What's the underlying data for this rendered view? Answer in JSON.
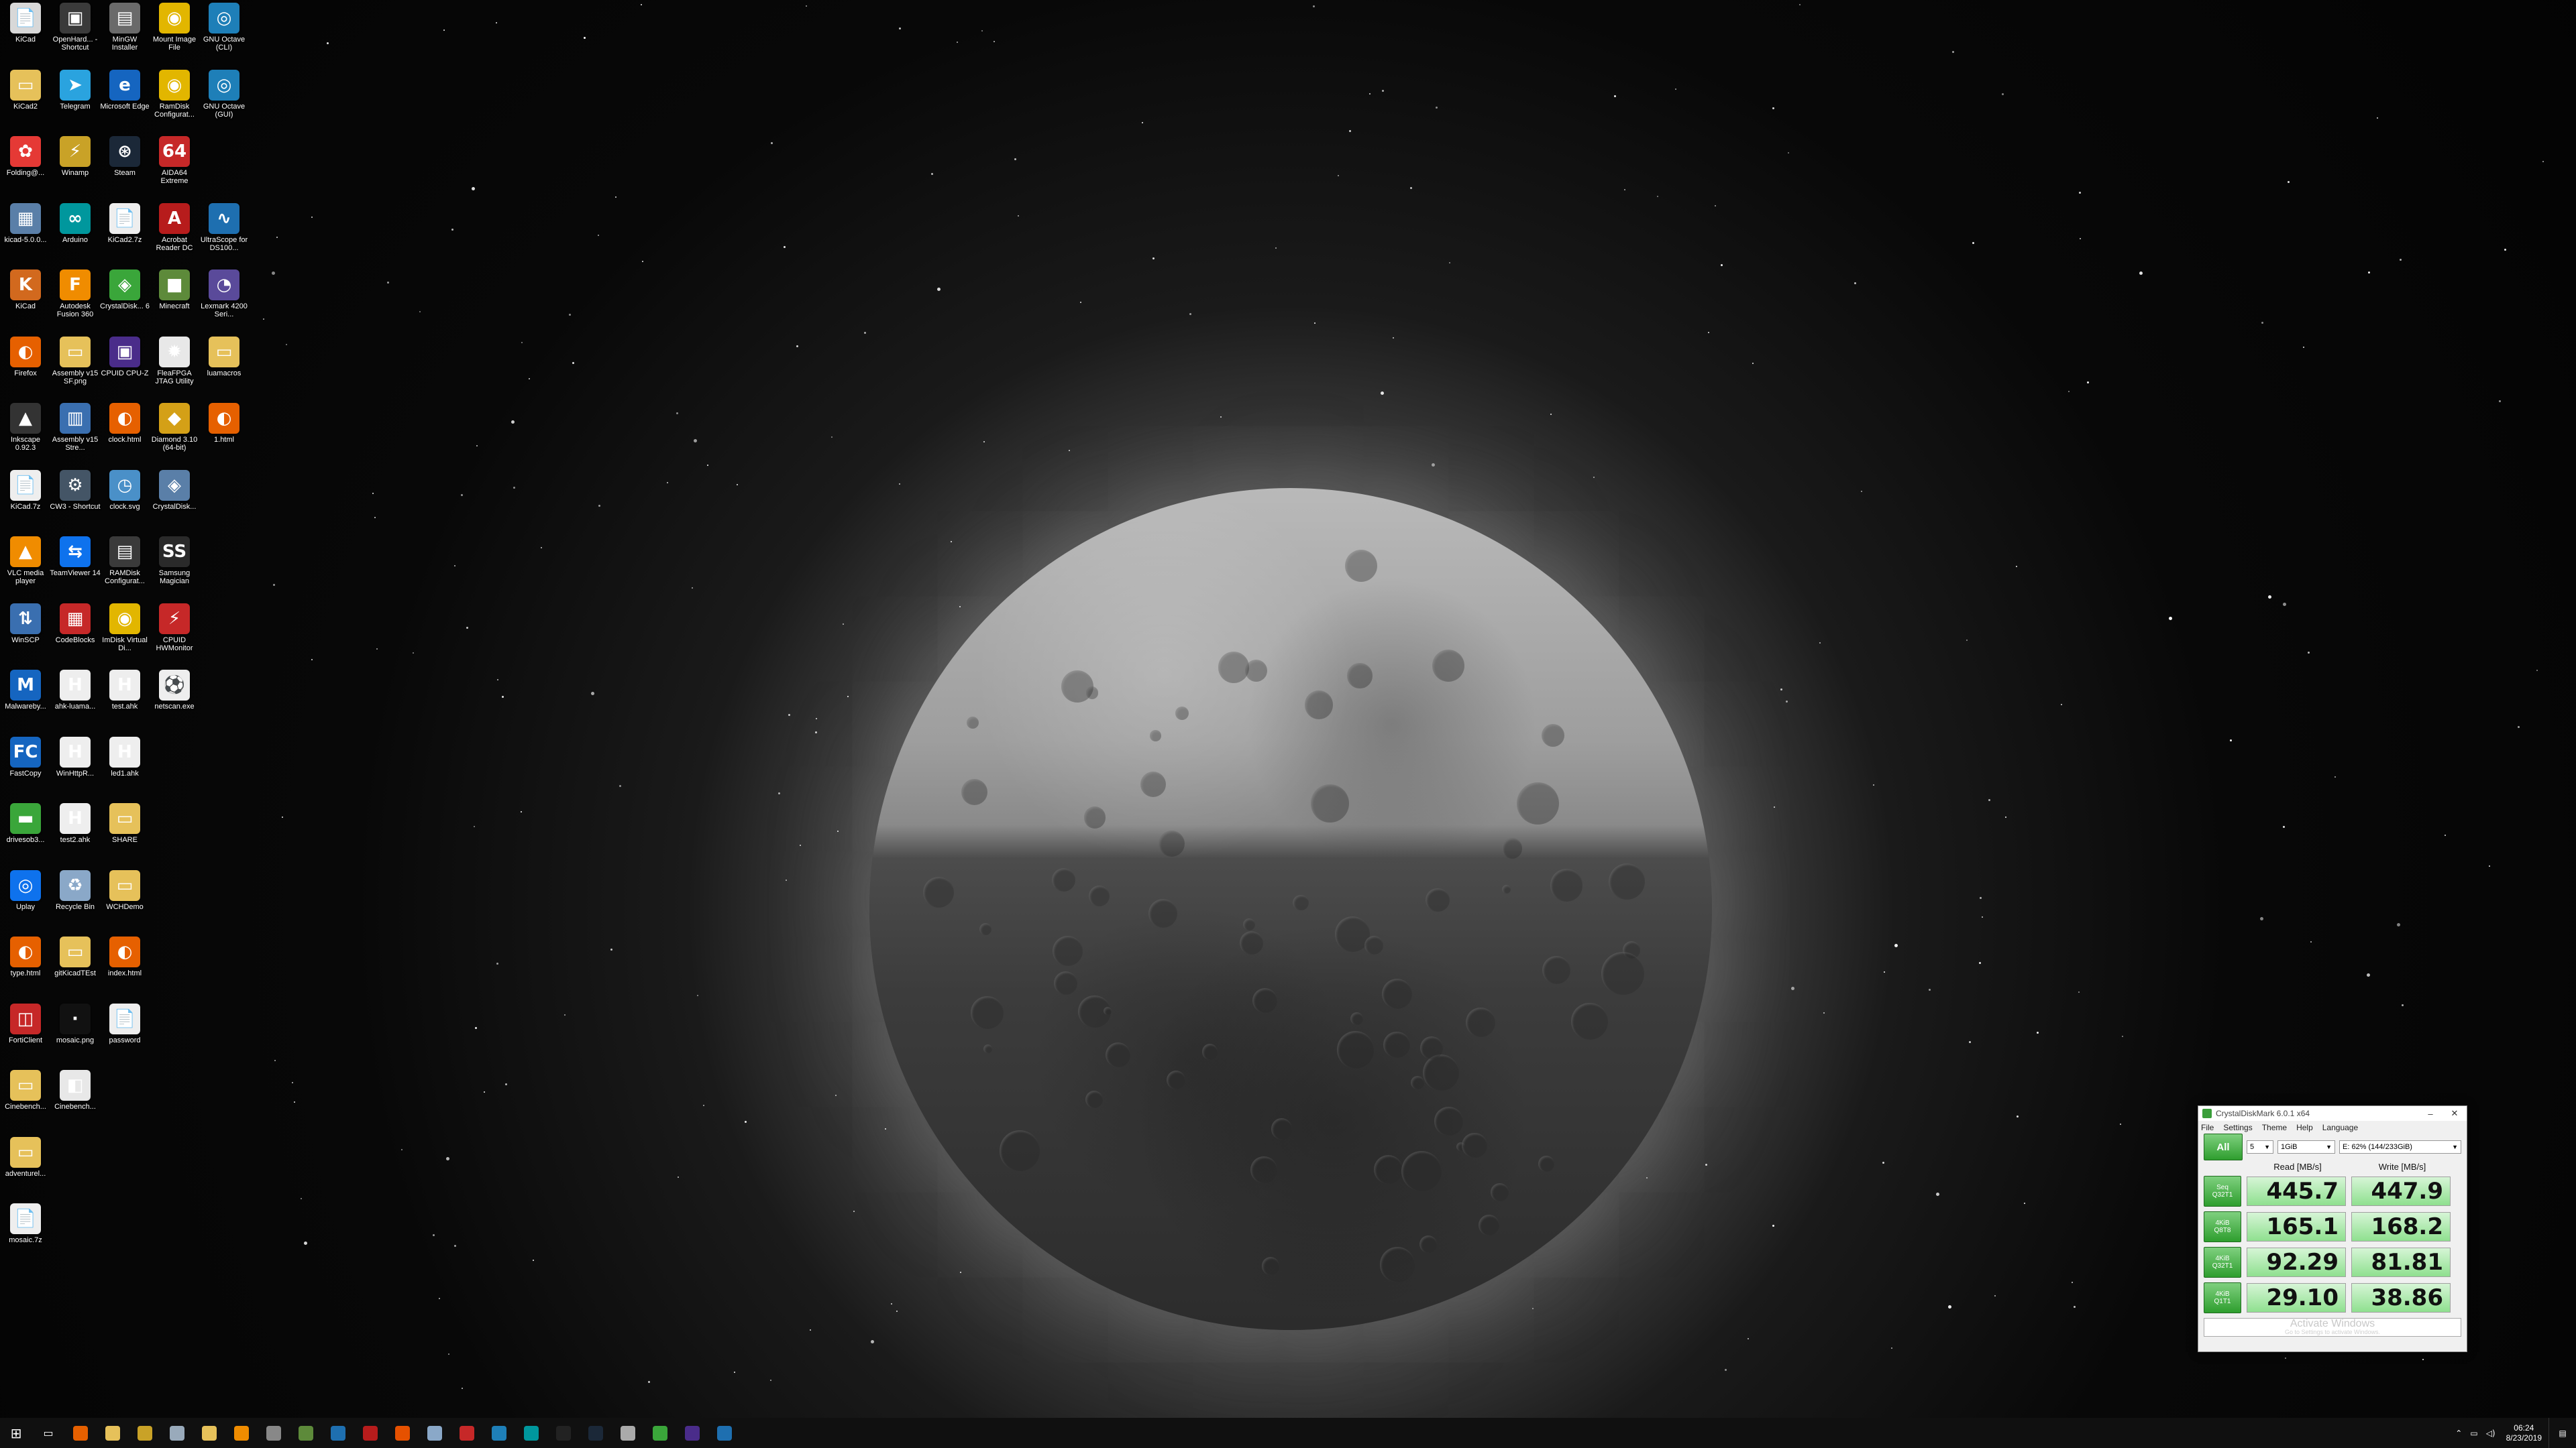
{
  "desktop_icons": [
    {
      "label": "KiCad",
      "color": "#d8d8d8",
      "glyph": "📄"
    },
    {
      "label": "OpenHard... - Shortcut",
      "color": "#3a3a3a",
      "glyph": "▣"
    },
    {
      "label": "MinGW Installer",
      "color": "#6a6a6a",
      "glyph": "▤"
    },
    {
      "label": "Mount Image File",
      "color": "#e2b600",
      "glyph": "◉"
    },
    {
      "label": "GNU Octave (CLI)",
      "color": "#1e7fb8",
      "glyph": "◎"
    },
    {
      "label": "KiCad2",
      "color": "#e6c15a",
      "glyph": "▭"
    },
    {
      "label": "Telegram",
      "color": "#2aa3df",
      "glyph": "➤"
    },
    {
      "label": "Microsoft Edge",
      "color": "#1565c0",
      "glyph": "e"
    },
    {
      "label": "RamDisk Configurat...",
      "color": "#e2b600",
      "glyph": "◉"
    },
    {
      "label": "GNU Octave (GUI)",
      "color": "#1e7fb8",
      "glyph": "◎"
    },
    {
      "label": "Folding@...",
      "color": "#e53935",
      "glyph": "✿"
    },
    {
      "label": "Winamp",
      "color": "#c9a227",
      "glyph": "⚡"
    },
    {
      "label": "Steam",
      "color": "#1b2838",
      "glyph": "⊛"
    },
    {
      "label": "AIDA64 Extreme",
      "color": "#c62828",
      "glyph": "64"
    },
    {
      "label": "kicad-5.0.0...",
      "color": "#5a7fa8",
      "glyph": "▦"
    },
    {
      "label": "Arduino",
      "color": "#00979d",
      "glyph": "∞"
    },
    {
      "label": "KiCad2.7z",
      "color": "#eeeeee",
      "glyph": "📄"
    },
    {
      "label": "Acrobat Reader DC",
      "color": "#b71c1c",
      "glyph": "A"
    },
    {
      "label": "UltraScope for DS100...",
      "color": "#1e6fb0",
      "glyph": "∿"
    },
    {
      "label": "KiCad",
      "color": "#d2691e",
      "glyph": "K"
    },
    {
      "label": "Autodesk Fusion 360",
      "color": "#f08c00",
      "glyph": "F"
    },
    {
      "label": "CrystalDisk... 6",
      "color": "#3aa63a",
      "glyph": "◈"
    },
    {
      "label": "Minecraft",
      "color": "#5d8a3a",
      "glyph": "■"
    },
    {
      "label": "Lexmark 4200 Seri...",
      "color": "#5a4a9a",
      "glyph": "◔"
    },
    {
      "label": "Firefox",
      "color": "#e66000",
      "glyph": "◐"
    },
    {
      "label": "Assembly v15 SF.png",
      "color": "#e6c15a",
      "glyph": "▭"
    },
    {
      "label": "CPUID CPU-Z",
      "color": "#4a2c8a",
      "glyph": "▣"
    },
    {
      "label": "FleaFPGA JTAG Utility",
      "color": "#e8e8e8",
      "glyph": "✹"
    },
    {
      "label": "luamacros",
      "color": "#e6c15a",
      "glyph": "▭"
    },
    {
      "label": "Inkscape 0.92.3",
      "color": "#333333",
      "glyph": "▲"
    },
    {
      "label": "Assembly v15 Stre...",
      "color": "#3a6fb0",
      "glyph": "▥"
    },
    {
      "label": "clock.html",
      "color": "#e66000",
      "glyph": "◐"
    },
    {
      "label": "Diamond 3.10 (64-bit)",
      "color": "#d4a017",
      "glyph": "◆"
    },
    {
      "label": "1.html",
      "color": "#e66000",
      "glyph": "◐"
    },
    {
      "label": "KiCad.7z",
      "color": "#eeeeee",
      "glyph": "📄"
    },
    {
      "label": "CW3 - Shortcut",
      "color": "#445566",
      "glyph": "⚙"
    },
    {
      "label": "clock.svg",
      "color": "#4a90c8",
      "glyph": "◷"
    },
    {
      "label": "CrystalDisk...",
      "color": "#5a7fa8",
      "glyph": "◈"
    },
    {
      "label": "VLC media player",
      "color": "#f08c00",
      "glyph": "▲"
    },
    {
      "label": "TeamViewer 14",
      "color": "#0e72ed",
      "glyph": "⇆"
    },
    {
      "label": "RAMDisk Configurat...",
      "color": "#3a3a3a",
      "glyph": "▤"
    },
    {
      "label": "Samsung Magician",
      "color": "#2a2a2a",
      "glyph": "SS"
    },
    {
      "label": "WinSCP",
      "color": "#3a6fb0",
      "glyph": "⇅"
    },
    {
      "label": "CodeBlocks",
      "color": "#c62828",
      "glyph": "▦"
    },
    {
      "label": "ImDisk Virtual Di...",
      "color": "#e2b600",
      "glyph": "◉"
    },
    {
      "label": "CPUID HWMonitor",
      "color": "#c62828",
      "glyph": "⚡"
    },
    {
      "label": "Malwareby...",
      "color": "#1565c0",
      "glyph": "M"
    },
    {
      "label": "ahk-luama...",
      "color": "#eeeeee",
      "glyph": "H"
    },
    {
      "label": "test.ahk",
      "color": "#eeeeee",
      "glyph": "H"
    },
    {
      "label": "netscan.exe",
      "color": "#eeeeee",
      "glyph": "⚽"
    },
    {
      "label": "FastCopy",
      "color": "#1565c0",
      "glyph": "FC"
    },
    {
      "label": "WinHttpR...",
      "color": "#eeeeee",
      "glyph": "H"
    },
    {
      "label": "led1.ahk",
      "color": "#eeeeee",
      "glyph": "H"
    },
    {
      "label": "drivesob3...",
      "color": "#3aa63a",
      "glyph": "▬"
    },
    {
      "label": "test2.ahk",
      "color": "#eeeeee",
      "glyph": "H"
    },
    {
      "label": "SHARE",
      "color": "#e6c15a",
      "glyph": "▭"
    },
    {
      "label": "Uplay",
      "color": "#0e72ed",
      "glyph": "◎"
    },
    {
      "label": "Recycle Bin",
      "color": "#8aa8c8",
      "glyph": "♻"
    },
    {
      "label": "WCHDemo",
      "color": "#e6c15a",
      "glyph": "▭"
    },
    {
      "label": "type.html",
      "color": "#e66000",
      "glyph": "◐"
    },
    {
      "label": "gitKicadTEst",
      "color": "#e6c15a",
      "glyph": "▭"
    },
    {
      "label": "index.html",
      "color": "#e66000",
      "glyph": "◐"
    },
    {
      "label": "FortiClient",
      "color": "#c62828",
      "glyph": "◫"
    },
    {
      "label": "mosaic.png",
      "color": "#111111",
      "glyph": "·"
    },
    {
      "label": "password",
      "color": "#eeeeee",
      "glyph": "📄"
    },
    {
      "label": "Cinebench...",
      "color": "#e6c15a",
      "glyph": "▭"
    },
    {
      "label": "Cinebench...",
      "color": "#e8e8e8",
      "glyph": "◧"
    },
    {
      "label": "adventurel...",
      "color": "#e6c15a",
      "glyph": "▭"
    },
    {
      "label": "mosaic.7z",
      "color": "#eeeeee",
      "glyph": "📄"
    }
  ],
  "crystaldiskmark": {
    "title": "CrystalDiskMark 6.0.1 x64",
    "menu": [
      "File",
      "Settings",
      "Theme",
      "Help",
      "Language"
    ],
    "all_button": "All",
    "count_select": "5",
    "size_select": "1GiB",
    "drive_select": "E: 62% (144/233GiB)",
    "read_header": "Read [MB/s]",
    "write_header": "Write [MB/s]",
    "rows": [
      {
        "label1": "Seq",
        "label2": "Q32T1",
        "read": "445.7",
        "write": "447.9"
      },
      {
        "label1": "4KiB",
        "label2": "Q8T8",
        "read": "165.1",
        "write": "168.2"
      },
      {
        "label1": "4KiB",
        "label2": "Q32T1",
        "read": "92.29",
        "write": "81.81"
      },
      {
        "label1": "4KiB",
        "label2": "Q1T1",
        "read": "29.10",
        "write": "38.86"
      }
    ],
    "comment_watermark": "Activate Windows",
    "comment_watermark_sub": "Go to Settings to activate Windows."
  },
  "taskbar": {
    "start_glyph": "⊞",
    "task_view_glyph": "▭",
    "apps": [
      {
        "name": "firefox",
        "color": "#e66000"
      },
      {
        "name": "file-explorer",
        "color": "#e6c15a"
      },
      {
        "name": "winamp",
        "color": "#c9a227"
      },
      {
        "name": "notepad",
        "color": "#9ab"
      },
      {
        "name": "explorer2",
        "color": "#e6c15a"
      },
      {
        "name": "fusion",
        "color": "#f08c00"
      },
      {
        "name": "network",
        "color": "#888"
      },
      {
        "name": "minecraft",
        "color": "#5d8a3a"
      },
      {
        "name": "app-blue",
        "color": "#1e6fb0"
      },
      {
        "name": "acrobat",
        "color": "#b71c1c"
      },
      {
        "name": "x-app",
        "color": "#e65100"
      },
      {
        "name": "steam",
        "color": "#8aa8c8"
      },
      {
        "name": "hwmonitor",
        "color": "#c62828"
      },
      {
        "name": "octave",
        "color": "#1e7fb8"
      },
      {
        "name": "arduino",
        "color": "#00979d"
      },
      {
        "name": "terminal",
        "color": "#222"
      },
      {
        "name": "steam2",
        "color": "#1b2838"
      },
      {
        "name": "settings",
        "color": "#aaa"
      },
      {
        "name": "crystaldiskmark",
        "color": "#3aa63a"
      },
      {
        "name": "cpu-z",
        "color": "#4a2c8a"
      },
      {
        "name": "scope",
        "color": "#1e6fb0"
      }
    ],
    "tray_time": "06:24",
    "tray_date": "8/23/2019"
  }
}
